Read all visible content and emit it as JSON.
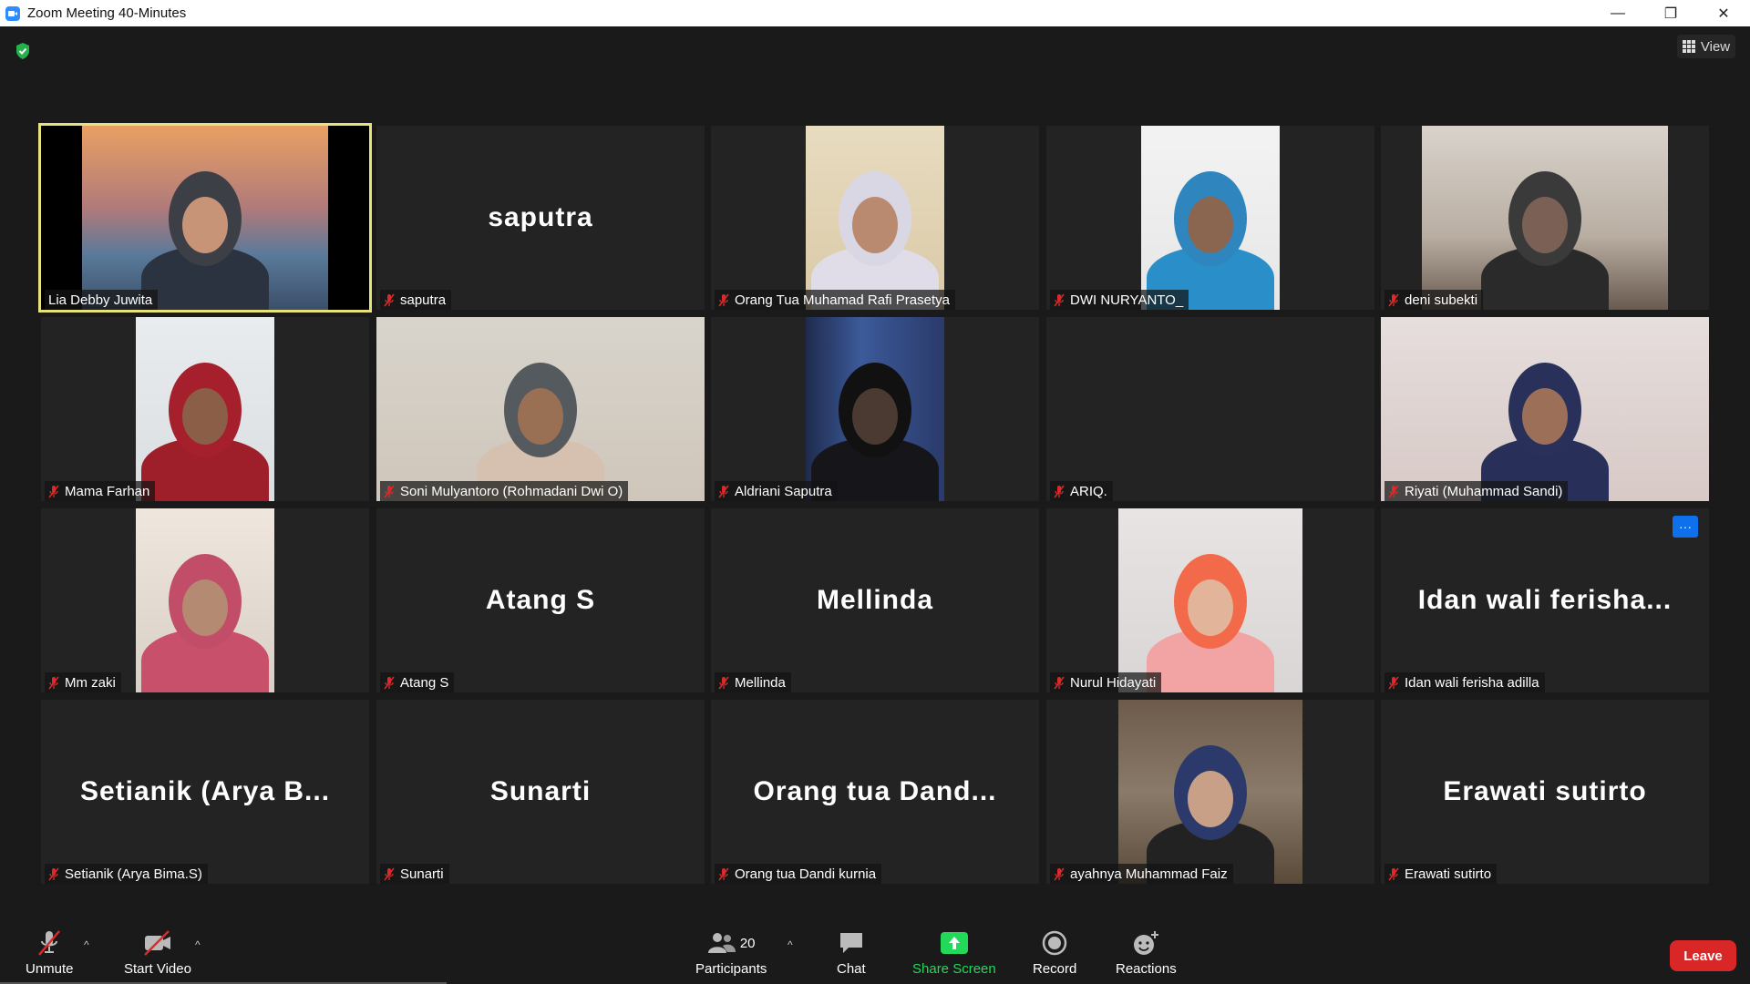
{
  "window": {
    "title": "Zoom Meeting 40-Minutes",
    "minimize": "—",
    "restore": "❐",
    "close": "✕"
  },
  "topbar": {
    "view_label": "View"
  },
  "participants": [
    {
      "label": "Lia Debby Juwita",
      "big_name": "",
      "video": true,
      "active": true,
      "muted": false
    },
    {
      "label": "saputra",
      "big_name": "saputra",
      "video": false,
      "muted": true
    },
    {
      "label": "Orang Tua Muhamad Rafi Prasetya",
      "big_name": "",
      "video": true,
      "muted": true
    },
    {
      "label": "DWI NURYANTO_",
      "big_name": "",
      "video": true,
      "muted": true
    },
    {
      "label": "deni subekti",
      "big_name": "",
      "video": true,
      "muted": true
    },
    {
      "label": "Mama Farhan",
      "big_name": "",
      "video": true,
      "muted": true
    },
    {
      "label": "Soni Mulyantoro (Rohmadani Dwi O)",
      "big_name": "",
      "video": true,
      "muted": true
    },
    {
      "label": "Aldriani Saputra",
      "big_name": "",
      "video": true,
      "muted": true
    },
    {
      "label": "ARIQ.",
      "big_name": "",
      "video": false,
      "muted": true
    },
    {
      "label": "Riyati (Muhammad Sandi)",
      "big_name": "",
      "video": true,
      "muted": true
    },
    {
      "label": "Mm zaki",
      "big_name": "",
      "video": true,
      "muted": true
    },
    {
      "label": "Atang S",
      "big_name": "Atang S",
      "video": false,
      "muted": true
    },
    {
      "label": "Mellinda",
      "big_name": "Mellinda",
      "video": false,
      "muted": true
    },
    {
      "label": "Nurul Hidayati",
      "big_name": "",
      "video": true,
      "muted": true
    },
    {
      "label": "Idan wali ferisha adilla",
      "big_name": "Idan wali ferisha...",
      "video": false,
      "muted": true,
      "more": "···"
    },
    {
      "label": "Setianik (Arya Bima.S)",
      "big_name": "Setianik (Arya B...",
      "video": false,
      "muted": true
    },
    {
      "label": "Sunarti",
      "big_name": "Sunarti",
      "video": false,
      "muted": true
    },
    {
      "label": "Orang tua Dandi kurnia",
      "big_name": "Orang tua Dand...",
      "video": false,
      "muted": true
    },
    {
      "label": "ayahnya Muhammad Faiz",
      "big_name": "",
      "video": true,
      "muted": true
    },
    {
      "label": "Erawati sutirto",
      "big_name": "Erawati sutirto",
      "video": false,
      "muted": true
    }
  ],
  "toolbar": {
    "unmute": "Unmute",
    "start_video": "Start Video",
    "participants": "Participants",
    "participants_count": "20",
    "chat": "Chat",
    "share_screen": "Share Screen",
    "record": "Record",
    "reactions": "Reactions",
    "leave": "Leave",
    "caret": "^"
  },
  "colors": {
    "active_border": "#e8e27a",
    "share_green": "#23d959",
    "leave_red": "#d92626",
    "mute_red": "#e02828",
    "more_blue": "#0e71eb"
  }
}
